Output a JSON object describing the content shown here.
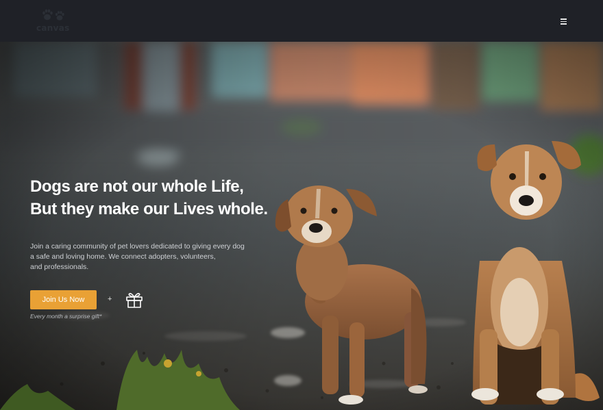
{
  "header": {
    "logo_text": "canvas",
    "logo_icon": "paw-prints-icon",
    "menu_icon": "hamburger-menu-icon"
  },
  "hero": {
    "headline_line1": "Dogs are not our whole Life,",
    "headline_line2": "But they make our Lives whole.",
    "description_line1": "Join a caring community of pet lovers dedicated to giving every dog",
    "description_line2": "a safe and loving home. We connect adopters, volunteers,",
    "description_line3": "and professionals.",
    "cta_label": "Join Us Now",
    "plus": "+",
    "gift_icon": "gift-icon",
    "gift_note": "Every month a surprise gift*"
  },
  "colors": {
    "header_bg": "#1f2127",
    "accent": "#e9a135",
    "headline": "#ffffff"
  }
}
